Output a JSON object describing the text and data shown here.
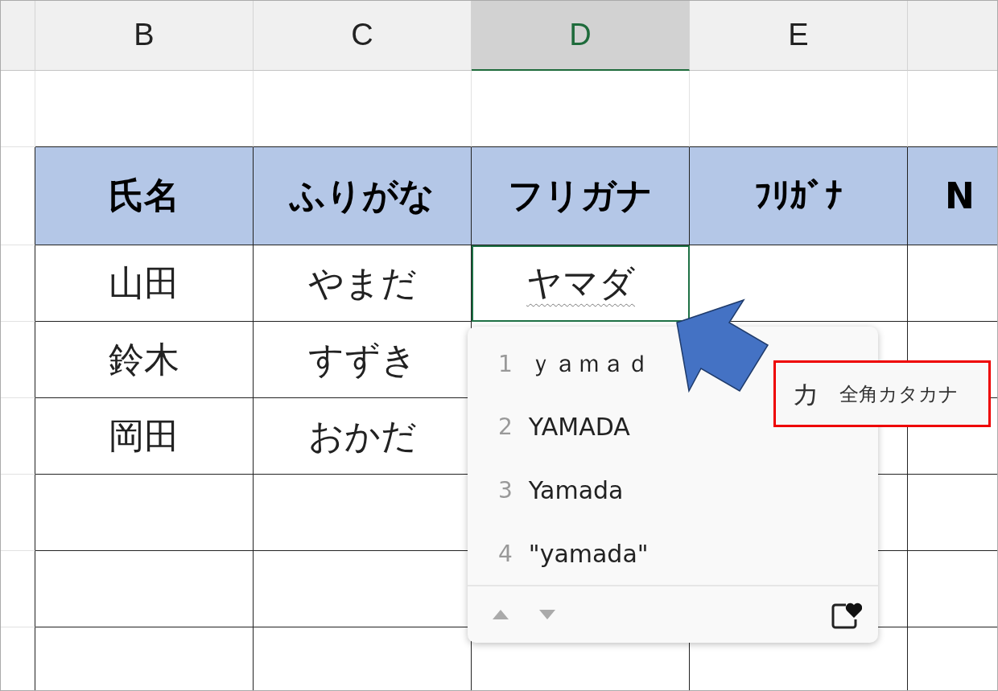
{
  "column_headers": [
    {
      "selected": false
    },
    {
      "label": "B",
      "selected": false
    },
    {
      "label": "C",
      "selected": false
    },
    {
      "label": "D",
      "selected": true
    },
    {
      "label": "E",
      "selected": false
    },
    {
      "selected": false
    }
  ],
  "table": {
    "header": [
      "氏名",
      "ふりがな",
      "フリガナ",
      "ﾌﾘｶﾞﾅ",
      "N"
    ],
    "rows": [
      {
        "cells": [
          {
            "text": "山田",
            "selected": false,
            "composing": false
          },
          {
            "text": "やまだ",
            "selected": false,
            "composing": false
          },
          {
            "text": "ヤマダ",
            "selected": true,
            "composing": true
          }
        ]
      },
      {
        "cells": [
          {
            "text": "鈴木",
            "selected": false,
            "composing": false
          },
          {
            "text": "すずき",
            "selected": false,
            "composing": false
          }
        ]
      },
      {
        "cells": [
          {
            "text": "岡田",
            "selected": false,
            "composing": false
          },
          {
            "text": "おかだ",
            "selected": false,
            "composing": false
          }
        ]
      }
    ]
  },
  "candidates": {
    "items": [
      {
        "number": "1",
        "text": "ｙａｍａｄ"
      },
      {
        "number": "2",
        "text": "YAMADA"
      },
      {
        "number": "3",
        "text": "Yamada"
      },
      {
        "number": "4",
        "text": "\"yamada\""
      }
    ]
  },
  "ime_mode": {
    "icon_char": "カ",
    "label": "全角カタカナ"
  }
}
